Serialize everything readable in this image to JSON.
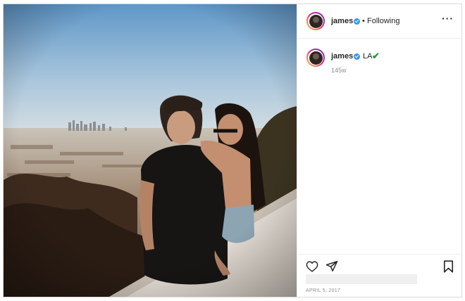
{
  "post": {
    "username": "james",
    "separator": "•",
    "follow_status": "Following",
    "more_icon": "more-horizontal-icon",
    "caption": {
      "username": "james",
      "text": "LA",
      "emoji": "✔"
    },
    "time_ago": "145w",
    "date": "APRIL 5, 2017",
    "photo_description": "couple sitting on ledge overlooking city"
  },
  "colors": {
    "verified": "#3897f0",
    "check": "#1e9e3a",
    "text": "#262626",
    "muted": "#8e8e8e",
    "border": "#dbdbdb"
  }
}
